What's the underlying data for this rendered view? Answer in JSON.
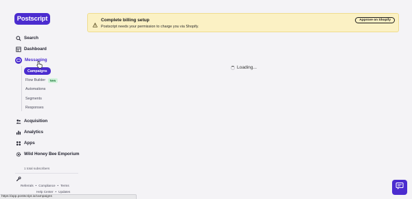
{
  "sidebar": {
    "logo": "Postscript",
    "nav": {
      "search": "Search",
      "dashboard": "Dashboard",
      "messaging": "Messaging",
      "acquisition": "Acquisition",
      "analytics": "Analytics",
      "apps": "Apps",
      "shop": "Wild Honey Bee Emporium"
    },
    "messaging_sub": {
      "campaigns": "Campaigns",
      "flow_builder": "Flow Builder",
      "flow_builder_badge": "New",
      "automations": "Automations",
      "segments": "Segments",
      "responses": "Responses"
    },
    "subscribers": "1 total subscribers",
    "admin": "Postscript Admin",
    "footer": {
      "referrals": "Referrals",
      "compliance": "Compliance",
      "terms": "Terms",
      "help_center": "Help Center",
      "updates": "Updates",
      "separator": "•"
    }
  },
  "banner": {
    "title": "Complete billing setup",
    "text": "Postscript needs your permission to charge you via Shopify.",
    "button": "Approve on Shopify"
  },
  "main": {
    "loading": "Loading..."
  },
  "status_bar": {
    "url": "https://app.postscript.io/campaigns"
  },
  "colors": {
    "brand": "#4b2ccf",
    "banner_bg": "#fbf1c4",
    "page_bg": "#f4f3f6"
  },
  "icons": {
    "search": "search-icon",
    "dashboard": "dashboard-icon",
    "messaging": "chat-bubble-icon",
    "acquisition": "people-icon",
    "analytics": "bar-chart-icon",
    "apps": "apps-grid-icon",
    "shop": "gear-icon",
    "admin": "wrench-icon",
    "warning": "warning-icon",
    "chat": "chat-support-icon"
  }
}
